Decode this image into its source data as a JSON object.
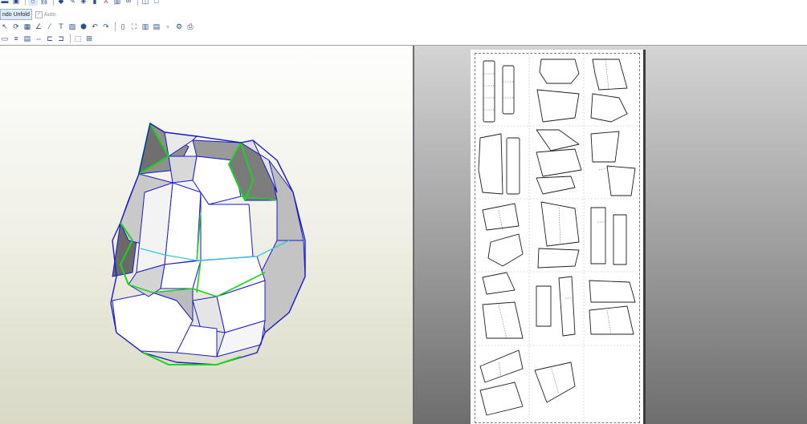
{
  "toolbar": {
    "undo_unfold_label": "ndo Unfold",
    "auto_label": "Auto",
    "auto_checked": true,
    "row1_icons": [
      "save-icon",
      "light-bulb-icon",
      "link-icon",
      "paint-icon",
      "wand-icon",
      "cube-icon",
      "cylinder-icon",
      "axis-icon",
      "pages-icon",
      "join-icon",
      "split-view-icon",
      "window-icon"
    ],
    "row2_glyphs": {
      "text_tool": "T",
      "undo": "↶",
      "redo": "↷"
    },
    "row2_icons": [
      "pointer-icon",
      "rotate-icon",
      "grid-icon",
      "angle-icon",
      "line-icon",
      "text-tool-icon",
      "image-icon",
      "box-icon",
      "undo-icon",
      "redo-icon",
      "book-icon",
      "fit-icon",
      "columns-icon",
      "document-icon",
      "page-icon",
      "settings-icon",
      "print-icon"
    ],
    "row3_icons": [
      "arrange-icon",
      "stack-icon",
      "layer-icon",
      "flip-icon",
      "align-left-icon",
      "align-right-icon",
      "select-frame-icon",
      "select-all-icon"
    ]
  },
  "colors": {
    "fold_green": "#1ed21e",
    "edge_blue": "#1a1acc",
    "seam_cyan": "#32c8e6",
    "face_white": "#ffffff",
    "panel_gray": "#8a8a8a"
  }
}
